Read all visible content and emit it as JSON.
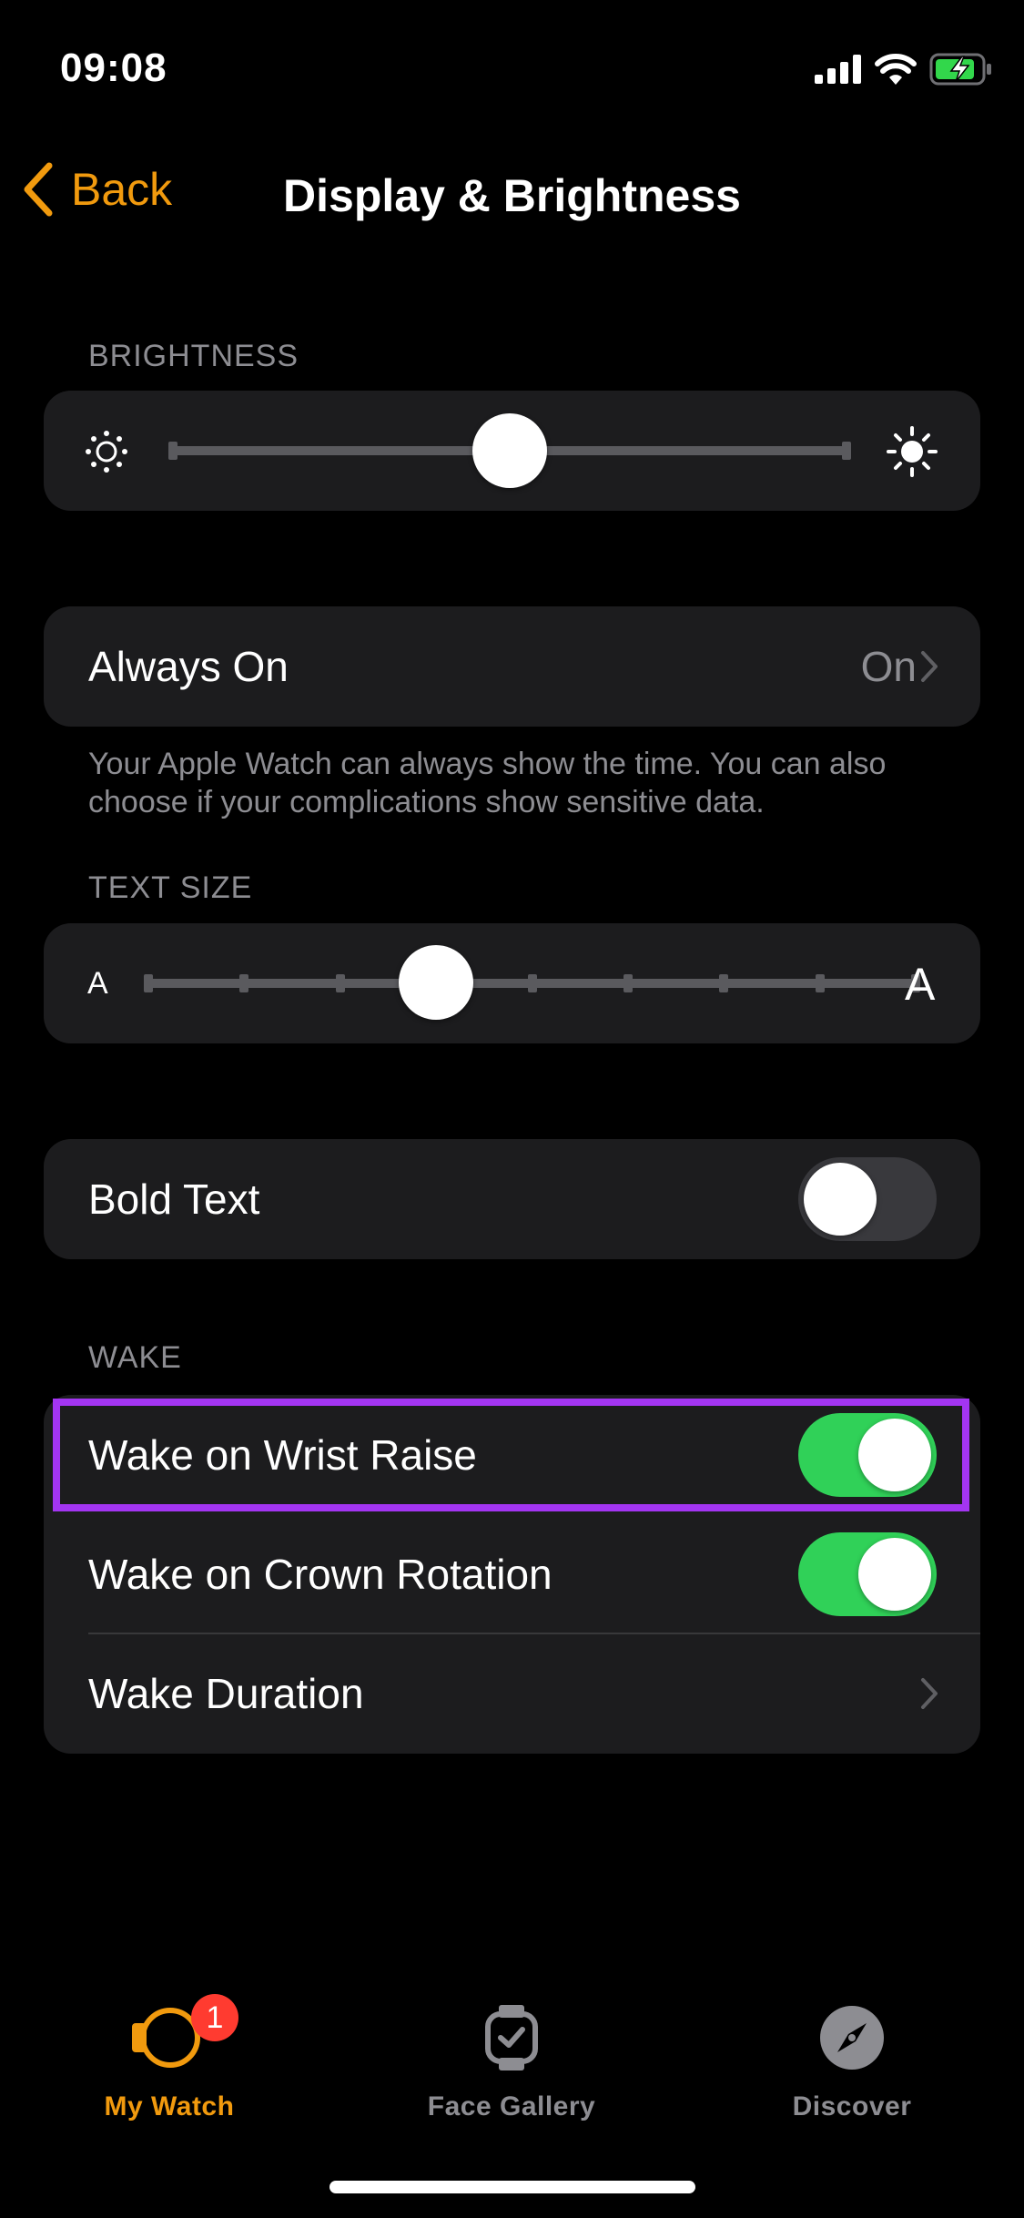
{
  "status_bar": {
    "time": "09:08"
  },
  "nav": {
    "back_label": "Back",
    "title": "Display & Brightness"
  },
  "brightness": {
    "header": "BRIGHTNESS",
    "level": 0.5
  },
  "always_on": {
    "label": "Always On",
    "value": "On",
    "footer": "Your Apple Watch can always show the time. You can also choose if your complications show sensitive data."
  },
  "text_size": {
    "header": "TEXT SIZE",
    "small_glyph": "A",
    "large_glyph": "A",
    "step": 3,
    "steps": 9
  },
  "bold_text": {
    "label": "Bold Text",
    "enabled": false
  },
  "wake": {
    "header": "WAKE",
    "items": [
      {
        "label": "Wake on Wrist Raise",
        "enabled": true
      },
      {
        "label": "Wake on Crown Rotation",
        "enabled": true
      },
      {
        "label": "Wake Duration"
      }
    ]
  },
  "tabs": [
    {
      "label": "My Watch",
      "icon": "watch-icon",
      "active": true,
      "badge": "1"
    },
    {
      "label": "Face Gallery",
      "icon": "face-gallery-icon",
      "active": false
    },
    {
      "label": "Discover",
      "icon": "compass-icon",
      "active": false
    }
  ],
  "colors": {
    "accent": "#f19a0e",
    "toggle_on": "#30d158",
    "highlight": "#a335f2",
    "badge": "#ff3b30"
  }
}
